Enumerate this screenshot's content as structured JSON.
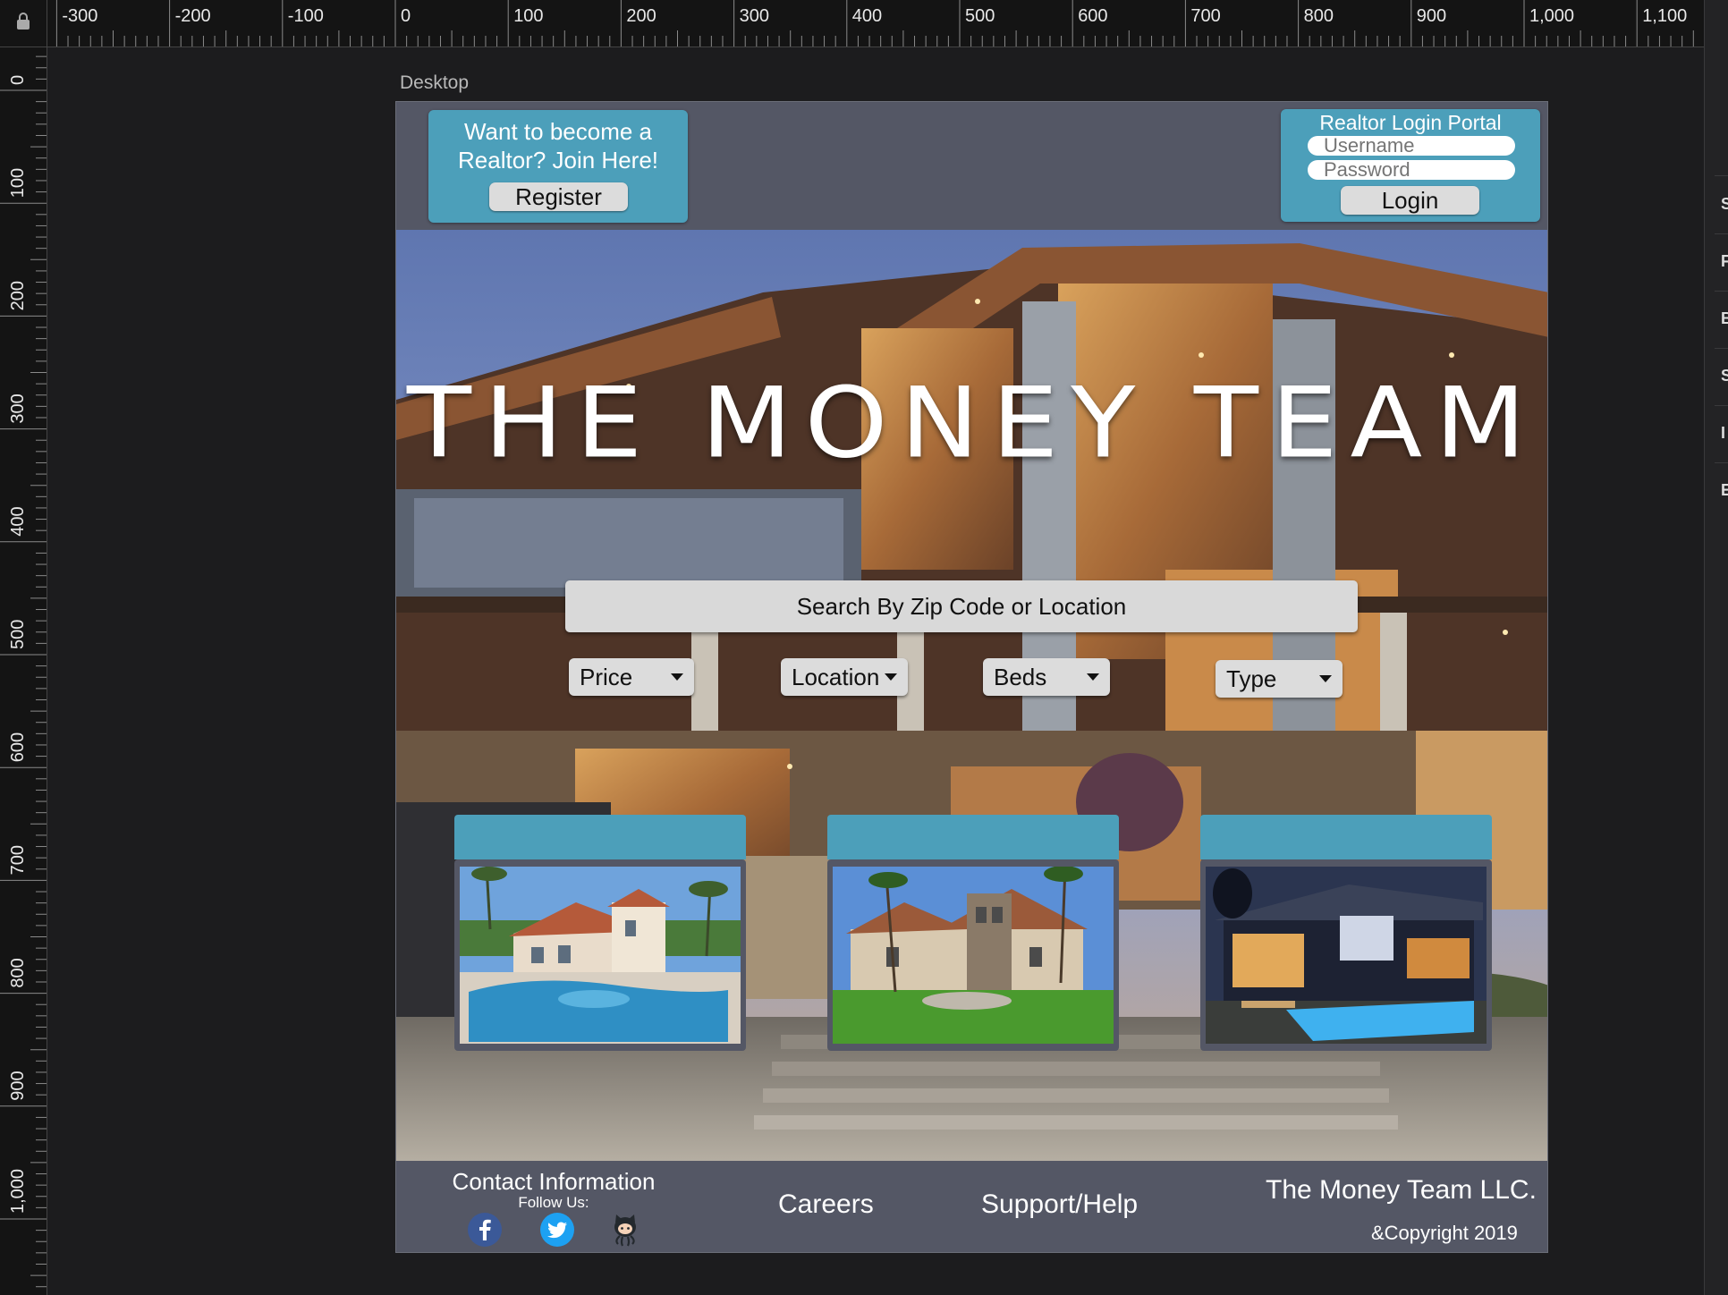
{
  "ruler": {
    "top_labels": [
      "-300",
      "-200",
      "-100",
      "0",
      "100",
      "200",
      "300",
      "400",
      "500",
      "600",
      "700",
      "800",
      "900",
      "1,000",
      "1,100"
    ],
    "left_labels": [
      "0",
      "100",
      "200",
      "300",
      "400",
      "500",
      "600",
      "700",
      "800",
      "900",
      "1,000"
    ]
  },
  "right_panel": {
    "letters": [
      "S",
      "F",
      "B",
      "S",
      "I",
      "E"
    ]
  },
  "artboard": {
    "label": "Desktop"
  },
  "header": {
    "promo_text": "Want to become a Realtor? Join Here!",
    "register_label": "Register",
    "login": {
      "title": "Realtor Login Portal",
      "username_placeholder": "Username",
      "password_placeholder": "Password",
      "button_label": "Login"
    }
  },
  "hero": {
    "title": "THE MONEY TEAM",
    "search_placeholder": "Search By Zip Code or Location",
    "filters": [
      "Price",
      "Location",
      "Beds",
      "Type"
    ]
  },
  "cards": [
    {
      "photo": "mansion-with-pool-photo"
    },
    {
      "photo": "stone-villa-photo"
    },
    {
      "photo": "modern-house-night-photo"
    }
  ],
  "footer": {
    "contact_title": "Contact Information",
    "follow_label": "Follow Us:",
    "social_icons": [
      "facebook-icon",
      "twitter-icon",
      "github-icon"
    ],
    "careers": "Careers",
    "support": "Support/Help",
    "company": "The Money Team LLC.",
    "copyright": "&Copyright 2019"
  },
  "colors": {
    "accent_teal": "#4c9fba",
    "header_slate": "#545765",
    "button_gray": "#dcdcdc",
    "canvas": "#1c1c1e"
  }
}
